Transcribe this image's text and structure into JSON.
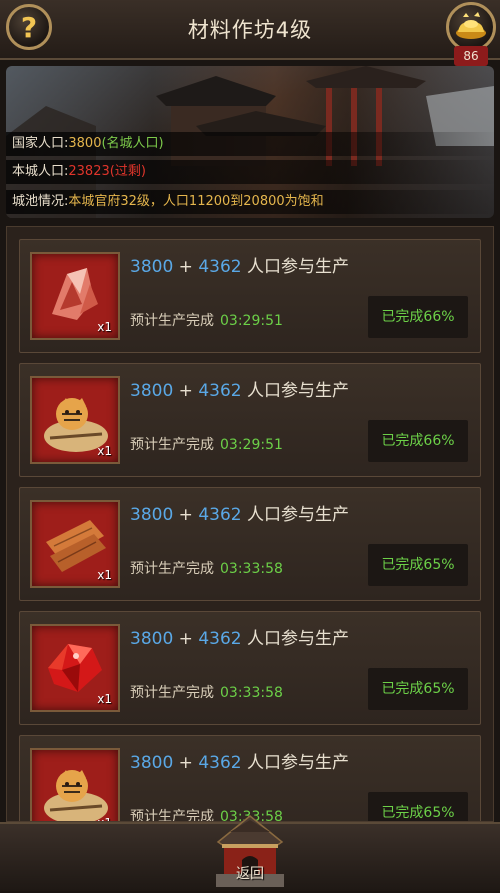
{
  "header": {
    "title": "材料作坊4级",
    "help_icon_text": "?",
    "ingot_count": "86"
  },
  "banner": {
    "national": {
      "label": "国家人口:",
      "value": "3800",
      "note": "(名城人口)"
    },
    "city": {
      "label": "本城人口:",
      "value": "23823",
      "note": "(过剩)"
    },
    "status": {
      "label": "城池情况:",
      "text": "本城官府32级，人口11200到20800为饱和"
    }
  },
  "rows": [
    {
      "item": "crystal-icon",
      "qty": "x1",
      "base": "3800",
      "plus": "+",
      "extra": "4362",
      "pop_label": "人口参与生产",
      "eta_label": "预计生产完成",
      "time": "03:29:51",
      "done": "已完成66%"
    },
    {
      "item": "tiger-icon",
      "qty": "x1",
      "base": "3800",
      "plus": "+",
      "extra": "4362",
      "pop_label": "人口参与生产",
      "eta_label": "预计生产完成",
      "time": "03:29:51",
      "done": "已完成66%"
    },
    {
      "item": "wood-planks-icon",
      "qty": "x1",
      "base": "3800",
      "plus": "+",
      "extra": "4362",
      "pop_label": "人口参与生产",
      "eta_label": "预计生产完成",
      "time": "03:33:58",
      "done": "已完成65%"
    },
    {
      "item": "ruby-icon",
      "qty": "x1",
      "base": "3800",
      "plus": "+",
      "extra": "4362",
      "pop_label": "人口参与生产",
      "eta_label": "预计生产完成",
      "time": "03:33:58",
      "done": "已完成65%"
    },
    {
      "item": "tiger-icon",
      "qty": "x1",
      "base": "3800",
      "plus": "+",
      "extra": "4362",
      "pop_label": "人口参与生产",
      "eta_label": "预计生产完成",
      "time": "03:33:58",
      "done": "已完成65%"
    }
  ],
  "footer": {
    "back_label": "返回"
  },
  "colors": {
    "accent_gold": "#e5b64d",
    "green": "#6cd048",
    "red": "#e0352b",
    "blue": "#5aa8e6"
  }
}
